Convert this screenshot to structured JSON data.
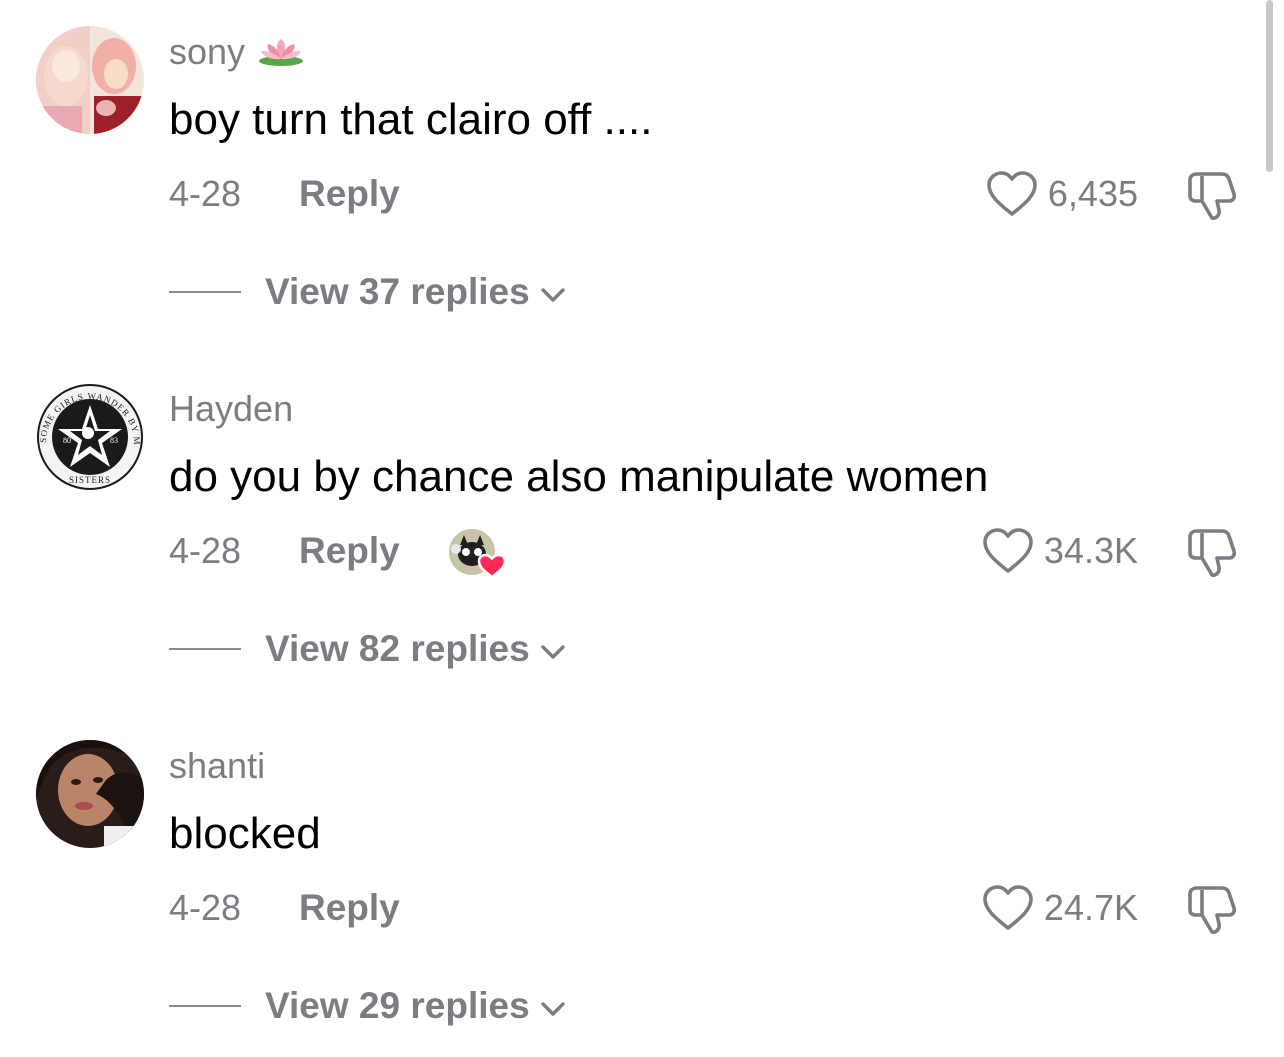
{
  "comments": [
    {
      "username": "sony",
      "username_emoji": "lotus",
      "text": "boy turn that clairo off ....",
      "date": "4-28",
      "reply_label": "Reply",
      "likes": "6,435",
      "view_replies": "View 37 replies",
      "creator_liked": false
    },
    {
      "username": "Hayden",
      "text": "do you by chance also manipulate women",
      "date": "4-28",
      "reply_label": "Reply",
      "likes": "34.3K",
      "view_replies": "View 82 replies",
      "creator_liked": true,
      "avatar_ring_text": "SOME GIRLS WANDER BY MISTAKE",
      "avatar_footer_text": "SISTERS",
      "avatar_year_left": "80",
      "avatar_year_right": "83"
    },
    {
      "username": "shanti",
      "text": "blocked",
      "date": "4-28",
      "reply_label": "Reply",
      "likes": "24.7K",
      "view_replies": "View 29 replies",
      "creator_liked": false
    }
  ],
  "icons": {
    "like": "heart-outline-icon",
    "dislike": "thumbs-down-icon",
    "expand": "chevron-down-icon",
    "creator_like_heart": "#fe2c55"
  },
  "colors": {
    "secondary_text": "#7c7d82",
    "primary_text": "#000000",
    "background": "#ffffff"
  }
}
